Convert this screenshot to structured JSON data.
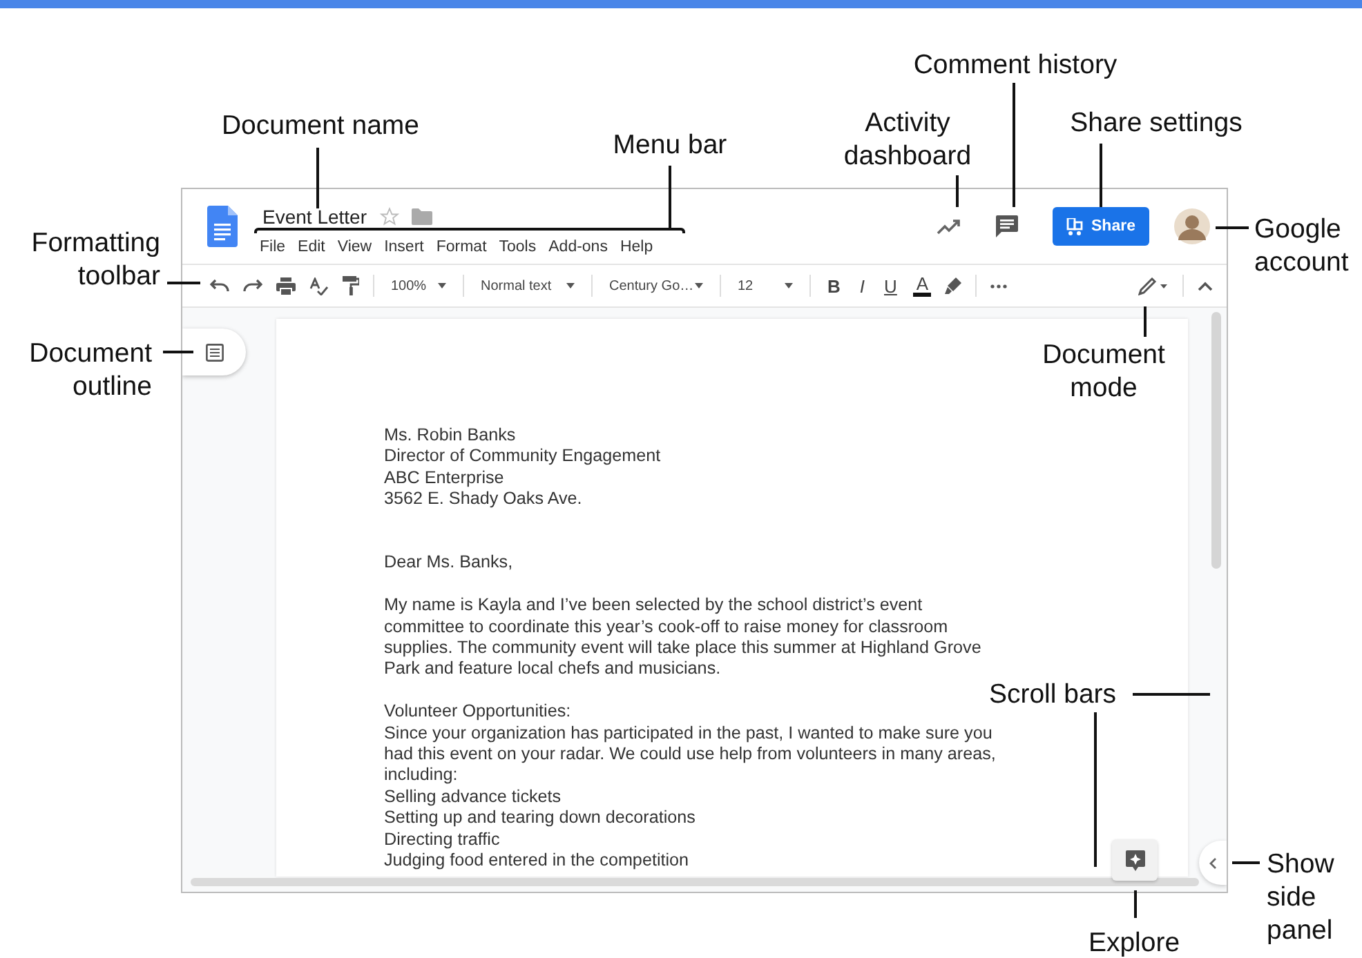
{
  "callouts": [
    {
      "text": "Document name"
    },
    {
      "text": "Menu bar"
    },
    {
      "text": "Activity dashboard"
    },
    {
      "text": "Comment history"
    },
    {
      "text": "Share settings"
    },
    {
      "text": "Google account"
    },
    {
      "text": "Formatting toolbar"
    },
    {
      "text": "Document outline"
    },
    {
      "text": "Document mode"
    },
    {
      "text": "Scroll bars"
    },
    {
      "text": "Explore"
    },
    {
      "text": "Show side panel"
    }
  ],
  "document": {
    "title": "Event Letter",
    "starred": false
  },
  "menu": [
    "File",
    "Edit",
    "View",
    "Insert",
    "Format",
    "Tools",
    "Add-ons",
    "Help"
  ],
  "share_button": "Share",
  "toolbar": {
    "zoom": "100%",
    "style": "Normal text",
    "font": "Century Go…",
    "size": "12",
    "format_buttons": [
      "B",
      "I",
      "U",
      "A"
    ]
  },
  "page_blocks": [
    {
      "lines": [
        "Ms. Robin Banks",
        "Director of Community Engagement",
        "ABC Enterprise",
        "3562 E. Shady Oaks Ave."
      ]
    },
    {
      "lines": [
        "Dear Ms. Banks,"
      ]
    },
    {
      "lines": [
        "My name is Kayla and I’ve been selected by the school district’s event",
        "committee to coordinate this year’s cook-off to raise money for classroom",
        "supplies. The community event will take place this summer at Highland Grove",
        "Park and feature local chefs and musicians."
      ]
    },
    {
      "lines": [
        "Volunteer Opportunities:",
        "Since your organization has participated in the past, I wanted to make sure you",
        "had this event on your radar. We could use help from volunteers in many areas,",
        "including:",
        "Selling advance tickets",
        "Setting up and tearing down decorations",
        "Directing traffic",
        "Judging food entered in the competition"
      ]
    }
  ]
}
